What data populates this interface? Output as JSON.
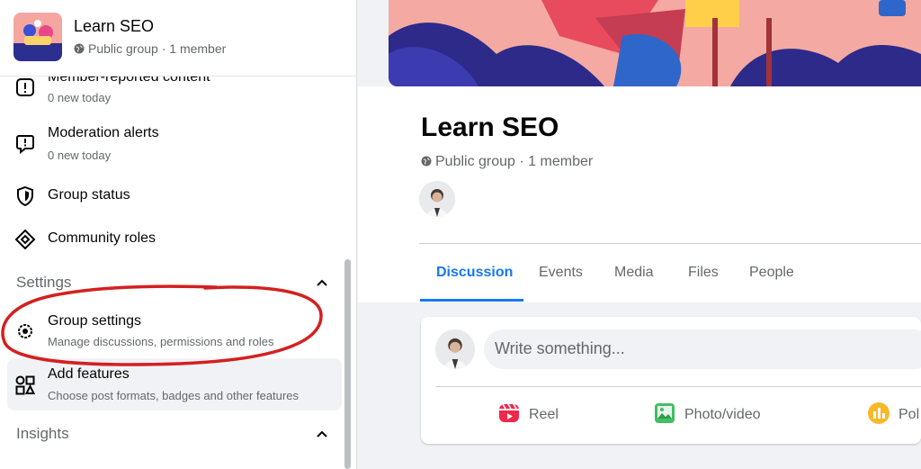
{
  "sidebar": {
    "group_name": "Learn SEO",
    "group_meta": "Public group · 1 member",
    "items": [
      {
        "label": "Member-reported content",
        "desc": "0 new today"
      },
      {
        "label": "Moderation alerts",
        "desc": "0 new today"
      },
      {
        "label": "Group status"
      },
      {
        "label": "Community roles"
      }
    ],
    "settings_section": "Settings",
    "settings_items": [
      {
        "label": "Group settings",
        "desc": "Manage discussions, permissions and roles"
      },
      {
        "label": "Add features",
        "desc": "Choose post formats, badges and other features"
      }
    ],
    "insights_section": "Insights"
  },
  "main": {
    "title": "Learn SEO",
    "meta": "Public group · 1 member",
    "tabs": [
      {
        "label": "Discussion",
        "active": true
      },
      {
        "label": "Events"
      },
      {
        "label": "Media"
      },
      {
        "label": "Files"
      },
      {
        "label": "People"
      }
    ],
    "composer": {
      "placeholder": "Write something...",
      "actions": [
        {
          "label": "Reel",
          "icon": "reel-icon"
        },
        {
          "label": "Photo/video",
          "icon": "photo-icon"
        },
        {
          "label": "Pol",
          "icon": "poll-icon"
        }
      ]
    }
  },
  "colors": {
    "accent": "#1877f2",
    "annotation": "#d42020",
    "muted": "#65676b"
  }
}
